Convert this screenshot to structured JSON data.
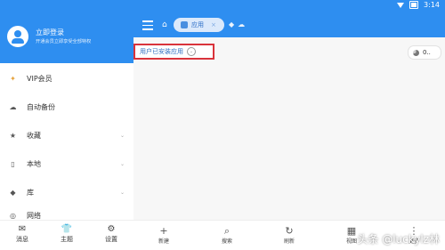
{
  "status": {
    "time": "3:14"
  },
  "sidebar": {
    "login_title": "立即登录",
    "login_subtitle": "开通会员立即享受全部特权",
    "items": [
      {
        "label": "VIP会员",
        "icon": "vip-icon",
        "chevron": false
      },
      {
        "label": "自动备份",
        "icon": "cloud-icon",
        "chevron": false
      },
      {
        "label": "收藏",
        "icon": "star-icon",
        "chevron": true
      },
      {
        "label": "本地",
        "icon": "phone-icon",
        "chevron": true
      },
      {
        "label": "库",
        "icon": "library-icon",
        "chevron": true
      },
      {
        "label": "网络",
        "icon": "network-icon",
        "chevron": false
      }
    ],
    "bottom_tabs": [
      {
        "label": "消息",
        "icon": "message-icon"
      },
      {
        "label": "主题",
        "icon": "theme-icon"
      },
      {
        "label": "设置",
        "icon": "settings-icon"
      }
    ]
  },
  "topbar": {
    "tab_label": "应用"
  },
  "content": {
    "filter_label": "用户已安装应用",
    "storage_label": "0.."
  },
  "toolbar": [
    {
      "label": "新建",
      "icon": "plus-icon"
    },
    {
      "label": "搜索",
      "icon": "search-icon"
    },
    {
      "label": "刷新",
      "icon": "refresh-icon"
    },
    {
      "label": "视图",
      "icon": "grid-view-icon"
    },
    {
      "label": "更多",
      "icon": "more-icon"
    }
  ],
  "watermark": "头条 @luckylz林",
  "colors": {
    "primary": "#2e8ef0",
    "highlight_border": "#d9333b"
  }
}
